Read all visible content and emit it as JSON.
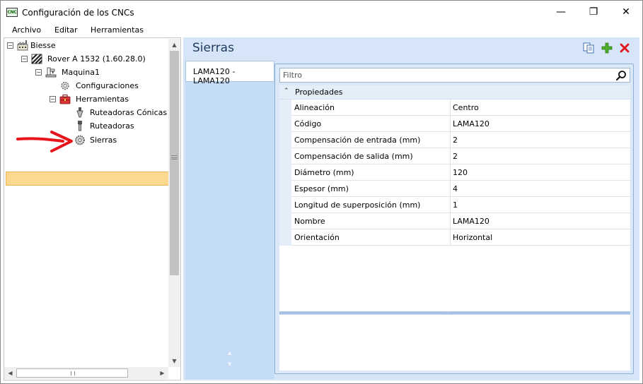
{
  "window": {
    "app_icon_text": "CNC",
    "title": "Configuración de los CNCs",
    "minimize_glyph": "—",
    "maximize_glyph": "❐",
    "close_glyph": "✕"
  },
  "menu": [
    "Archivo",
    "Editar",
    "Herramientas"
  ],
  "tree": {
    "nodes": [
      {
        "label": "Biesse",
        "icon": "factory-icon",
        "expanded": true
      },
      {
        "label": "Rover A 1532 (1.60.28.0)",
        "icon": "machine-stripes-icon",
        "expanded": true
      },
      {
        "label": "Maquina1",
        "icon": "machine-tool-icon",
        "expanded": true
      },
      {
        "label": "Configuraciones",
        "icon": "gear-settings-icon"
      },
      {
        "label": "Herramientas",
        "icon": "toolbox-icon",
        "expanded": true
      },
      {
        "label": "Ruteadoras Cónicas",
        "icon": "conical-router-icon"
      },
      {
        "label": "Ruteadoras",
        "icon": "router-icon"
      },
      {
        "label": "Sierras",
        "icon": "saw-blade-icon",
        "selected": true
      }
    ]
  },
  "main": {
    "title": "Sierras",
    "toolbar": {
      "copy_icon": "copy-icon",
      "add_icon": "add-icon",
      "delete_icon": "delete-icon"
    },
    "list_items": [
      "LAMA120 - LAMA120"
    ],
    "filter_placeholder": "Filtro",
    "category": "Propiedades",
    "properties": [
      {
        "name": "Alineación",
        "value": "Centro"
      },
      {
        "name": "Código",
        "value": "LAMA120"
      },
      {
        "name": "Compensación de entrada (mm)",
        "value": "2"
      },
      {
        "name": "Compensación de salida (mm)",
        "value": "2"
      },
      {
        "name": "Diámetro (mm)",
        "value": "120"
      },
      {
        "name": "Espesor (mm)",
        "value": "4"
      },
      {
        "name": "Longitud de superposición (mm)",
        "value": "1"
      },
      {
        "name": "Nombre",
        "value": "LAMA120"
      },
      {
        "name": "Orientación",
        "value": "Horizontal"
      }
    ]
  },
  "colors": {
    "selection": "#fcd98f",
    "panel_bg": "#d6e5f7",
    "annotation_arrow": "#e8141b",
    "add_green": "#4cae2a",
    "delete_red": "#e0161c"
  }
}
